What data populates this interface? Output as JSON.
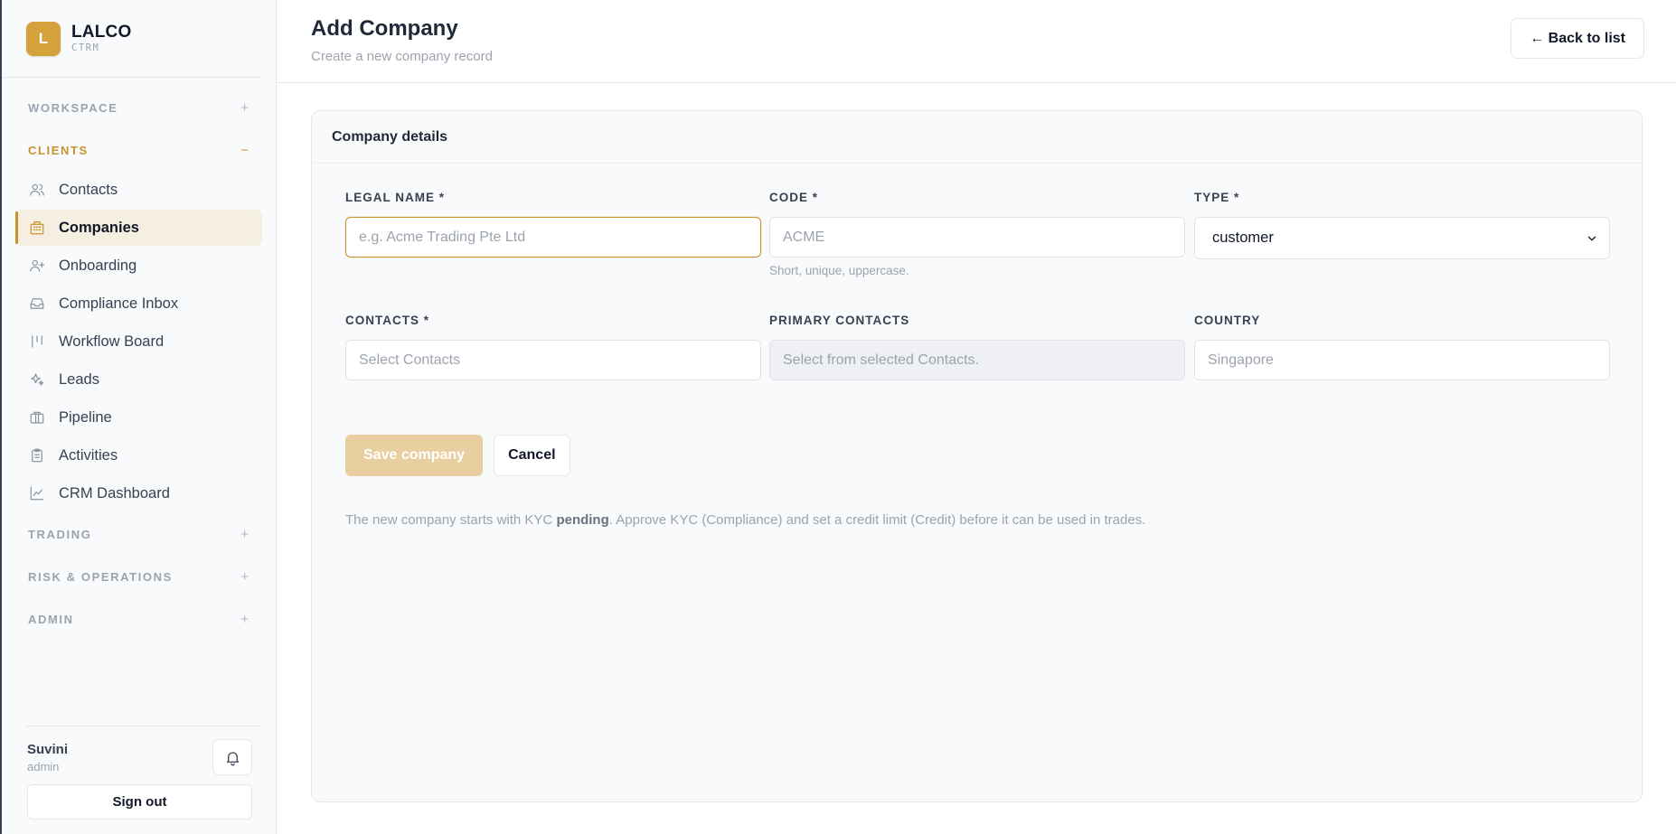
{
  "brand": {
    "logo_letter": "L",
    "name": "LALCO",
    "sub": "CTRM"
  },
  "sidebar": {
    "sections": {
      "workspace": {
        "label": "WORKSPACE",
        "toggle": "+"
      },
      "clients": {
        "label": "CLIENTS",
        "toggle": "−"
      },
      "trading": {
        "label": "TRADING",
        "toggle": "+"
      },
      "risk": {
        "label": "RISK & OPERATIONS",
        "toggle": "+"
      },
      "admin": {
        "label": "ADMIN",
        "toggle": "+"
      }
    },
    "items": [
      {
        "label": "Contacts",
        "icon": "users-icon"
      },
      {
        "label": "Companies",
        "icon": "building-icon",
        "active": true
      },
      {
        "label": "Onboarding",
        "icon": "user-plus-icon"
      },
      {
        "label": "Compliance Inbox",
        "icon": "inbox-icon"
      },
      {
        "label": "Workflow Board",
        "icon": "kanban-icon"
      },
      {
        "label": "Leads",
        "icon": "sparkles-icon"
      },
      {
        "label": "Pipeline",
        "icon": "briefcase-icon"
      },
      {
        "label": "Activities",
        "icon": "clipboard-icon"
      },
      {
        "label": "CRM Dashboard",
        "icon": "chart-line-icon"
      }
    ],
    "user": {
      "name": "Suvini",
      "role": "admin"
    },
    "sign_out_label": "Sign out"
  },
  "header": {
    "title": "Add Company",
    "subtitle": "Create a new company record",
    "back_label": "← Back to list"
  },
  "card": {
    "title": "Company details"
  },
  "form": {
    "legal_name": {
      "label": "LEGAL NAME *",
      "placeholder": "e.g. Acme Trading Pte Ltd",
      "value": ""
    },
    "code": {
      "label": "CODE *",
      "placeholder": "ACME",
      "help": "Short, unique, uppercase.",
      "value": ""
    },
    "type": {
      "label": "TYPE *",
      "value": "customer"
    },
    "contacts": {
      "label": "CONTACTS *",
      "placeholder": "Select Contacts"
    },
    "primary_contacts": {
      "label": "PRIMARY CONTACTS",
      "placeholder": "Select from selected Contacts."
    },
    "country": {
      "label": "COUNTRY",
      "placeholder": "Singapore"
    }
  },
  "actions": {
    "save_label": "Save company",
    "cancel_label": "Cancel"
  },
  "note": {
    "prefix": "The new company starts with KYC ",
    "strong": "pending",
    "suffix": ". Approve KYC (Compliance) and set a credit limit (Credit) before it can be used in trades."
  },
  "colors": {
    "accent": "#c8922a",
    "logo": "#d4a13a",
    "save_disabled": "#e9cf9f"
  }
}
